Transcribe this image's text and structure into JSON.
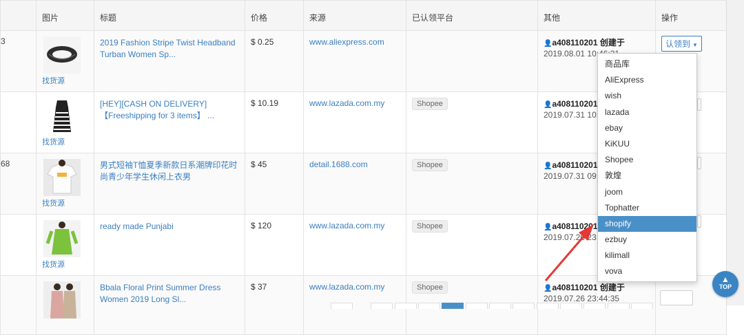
{
  "columns": {
    "image": "图片",
    "title": "标题",
    "price": "价格",
    "source": "来源",
    "claimed": "已认领平台",
    "other": "其他",
    "actions": "操作"
  },
  "rows": [
    {
      "edge": "3",
      "title": "2019 Fashion Stripe Twist Headband Turban Women Sp...",
      "price": "$ 0.25",
      "source": "www.aliexpress.com",
      "platform": "",
      "creator": "a408110201 创建于",
      "date": "2019.08.01 10:46:21",
      "find": "找货源",
      "claim": "认领到"
    },
    {
      "edge": "",
      "title": "[HEY][CASH ON DELIVERY]【Freeshipping for 3 items】 ...",
      "price": "$ 10.19",
      "source": "www.lazada.com.my",
      "platform": "Shopee",
      "creator": "a408110201 创",
      "date": "2019.07.31 10:0",
      "find": "找货源"
    },
    {
      "edge": "68",
      "title": "男式短袖T恤夏季新款日系潮牌印花时尚青少年学生休闲上衣男",
      "price": "$ 45",
      "source": "detail.1688.com",
      "platform": "Shopee",
      "creator": "a408110201 创",
      "date": "2019.07.31 09:5",
      "find": "找货源"
    },
    {
      "edge": "",
      "title": "ready made Punjabi",
      "price": "$ 120",
      "source": "www.lazada.com.my",
      "platform": "Shopee",
      "creator": "a408110201 创",
      "date": "2019.07.26 23:4",
      "find": "找货源"
    },
    {
      "edge": "",
      "title": "Bbala Floral Print Summer Dress Women 2019 Long Sl...",
      "price": "$ 37",
      "source": "www.lazada.com.my",
      "platform": "Shopee",
      "creator": "a408110201 创建于",
      "date": "2019.07.26 23:44:35",
      "find": ""
    }
  ],
  "dropdown": {
    "items": [
      "商品库",
      "AliExpress",
      "wish",
      "lazada",
      "ebay",
      "KiKUU",
      "Shopee",
      "敦煌",
      "joom",
      "Tophatter",
      "shopify",
      "ezbuy",
      "kilimall",
      "vova"
    ],
    "selected": "shopify"
  },
  "top_button": {
    "label": "TOP"
  },
  "colors": {
    "link": "#3a7fc1",
    "selected": "#4a90c8",
    "annotation_arrow": "#e53935"
  },
  "icons": {
    "creator": "user-icon",
    "scroll_top": "arrow-up-icon",
    "claim_caret": "caret-down-icon"
  }
}
